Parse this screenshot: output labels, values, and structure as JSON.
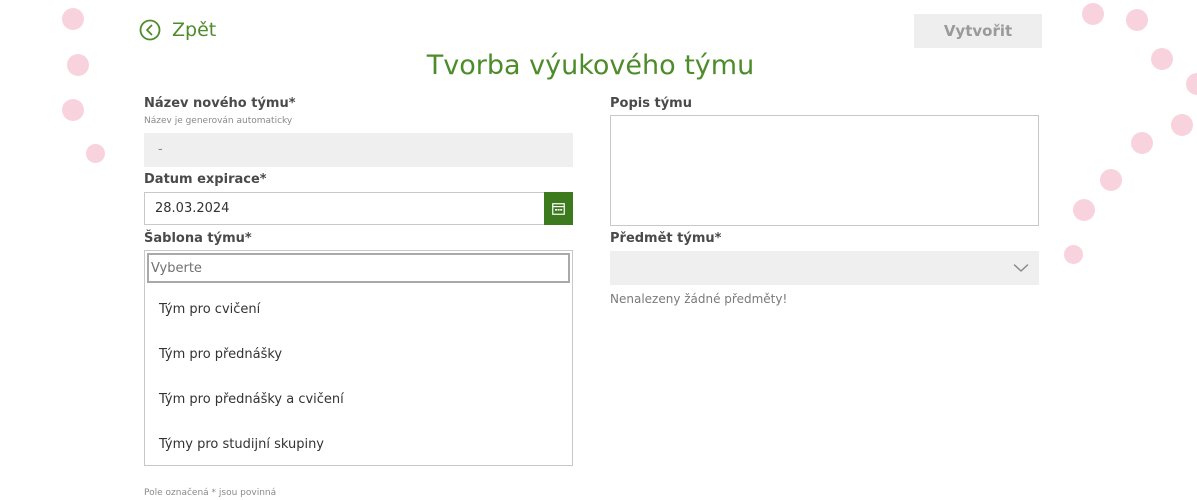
{
  "header": {
    "back_label": "Zpět",
    "create_label": "Vytvořit",
    "title": "Tvorba výukového týmu"
  },
  "form": {
    "name": {
      "label": "Název nového týmu*",
      "hint": "Název je generován automaticky",
      "value": "-"
    },
    "expiration": {
      "label": "Datum expirace*",
      "value": "28.03.2024"
    },
    "template": {
      "label": "Šablona týmu*",
      "placeholder": "Vyberte",
      "options": [
        "Tým pro cvičení",
        "Tým pro přednášky",
        "Tým pro přednášky a cvičení",
        "Týmy pro studijní skupiny"
      ]
    },
    "description": {
      "label": "Popis týmu"
    },
    "subject": {
      "label": "Předmět týmu*",
      "empty_message": "Nenalezeny žádné předměty!"
    },
    "required_note": "Pole označená * jsou povinná"
  },
  "colors": {
    "accent_green": "#4d8c2a",
    "dark_green": "#3d7a1d",
    "decor_pink": "#f8d3de",
    "disabled_gray": "#eeeeee"
  },
  "icons": {
    "back": "circle-arrow-left-icon",
    "calendar": "calendar-icon",
    "chevron": "chevron-down-icon"
  }
}
